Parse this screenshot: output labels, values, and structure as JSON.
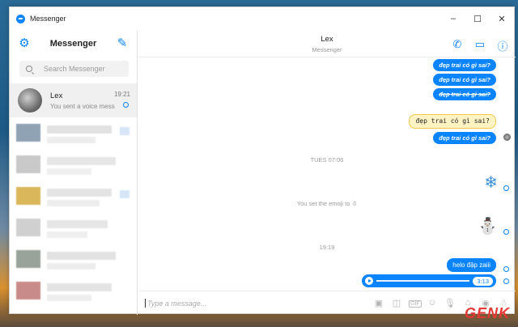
{
  "window": {
    "title": "Messenger",
    "controls": [
      "–",
      "☐",
      "✕"
    ]
  },
  "sidebar": {
    "title": "Messenger",
    "search_placeholder": "Search Messenger",
    "active_conversation": {
      "name": "Lex",
      "preview": "You sent a voice mess...",
      "time": "19:21"
    }
  },
  "chat": {
    "name": "Lex",
    "subtitle": "Messenger",
    "messages": [
      {
        "text": "đẹp trai có gì sai?"
      },
      {
        "text": "đẹp trai có gì sai?"
      },
      {
        "text": "đẹp trai có gì sai?"
      },
      {
        "text": "đẹp trai có gì sai?"
      },
      {
        "text": "đẹp trai có gì sai?"
      }
    ],
    "time_sep_1": "TUES 07:06",
    "emoji_1": "❄",
    "system_msg": "You set the emoji to",
    "emoji_2": "⛄",
    "time_sep_2": "19:19",
    "last_text": "helo đập zaiii",
    "voice_duration": "3:13",
    "composer_placeholder": "Type a message..."
  },
  "watermark": "GENK",
  "colors": {
    "accent": "#0a84ff",
    "highlight": "#fff3c4",
    "watermark": "#e53935"
  }
}
